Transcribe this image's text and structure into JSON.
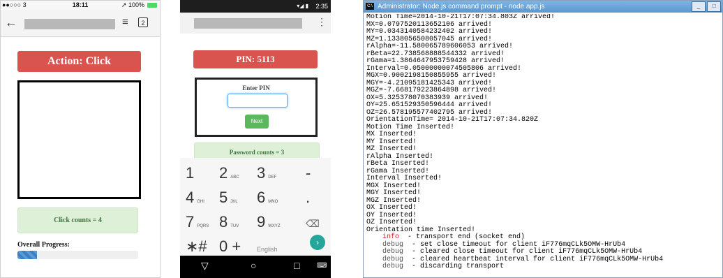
{
  "panel1": {
    "status": {
      "carrier": "●●○○○ 3",
      "time": "18:11",
      "battery": "➚ 100%"
    },
    "toolbar": {
      "back_icon": "arrow-left-icon",
      "menu_icon": "hamburger-icon",
      "tabs_count": "2"
    },
    "action_label": "Action: Click",
    "click_counts": "Click counts = 4",
    "progress_label": "Overall Progress:",
    "progress_fraction": 0.16
  },
  "panel2": {
    "status": {
      "icons": "▾◢ ▮",
      "time": "2:35"
    },
    "pin_label": "PIN: 5113",
    "enter_pin_label": "Enter PIN",
    "next_label": "Next",
    "password_counts": "Password counts = 3",
    "keys": [
      {
        "d": "1",
        "s": ""
      },
      {
        "d": "2",
        "s": "ABC"
      },
      {
        "d": "3",
        "s": "DEF"
      },
      {
        "d": "-",
        "s": ""
      },
      {
        "d": "4",
        "s": "GHI"
      },
      {
        "d": "5",
        "s": "JKL"
      },
      {
        "d": "6",
        "s": "MNO"
      },
      {
        "d": ".",
        "s": ""
      },
      {
        "d": "7",
        "s": "PQRS"
      },
      {
        "d": "8",
        "s": "TUV"
      },
      {
        "d": "9",
        "s": "WXYZ"
      },
      {
        "d": "⌫",
        "s": ""
      },
      {
        "d": "∗#",
        "s": ""
      },
      {
        "d": "0 +",
        "s": ""
      },
      {
        "d": "English",
        "s": ""
      },
      {
        "d": "",
        "s": ""
      }
    ],
    "nav": {
      "back": "▽",
      "home": "○",
      "recent": "□",
      "keyboard": "⌨"
    }
  },
  "panel3": {
    "title": "Administrator: Node.js command prompt - node  app.js",
    "lines": [
      "Motion Time=2014-10-21T17:07:34.803Z arrived!",
      "MX=0.0797520113652106 arrived!",
      "MY=0.0343140584232402 arrived!",
      "MZ=1.1338056508057045 arrived!",
      "rAlpha=-11.580065789606053 arrived!",
      "rBeta=22.738568888544332 arrived!",
      "rGama=1.3864647953759428 arrived!",
      "Interval=0.05000000074505806 arrived!",
      "MGX=0.9002198150855955 arrived!",
      "MGY=-4.21095181425343 arrived!",
      "MGZ=-7.668179223864898 arrived!",
      "OX=5.325378070383939 arrived!",
      "OY=25.651529350596444 arrived!",
      "OZ=26.578195577402795 arrived!",
      "OrientationTime= 2014-10-21T17:07:34.820Z",
      "Motion Time Inserted!",
      "MX Inserted!",
      "MY Inserted!",
      "MZ Inserted!",
      "rAlpha Inserted!",
      "rBeta Inserted!",
      "rGama Inserted!",
      "Interval Inserted!",
      "MGX Inserted!",
      "MGY Inserted!",
      "MGZ Inserted!",
      "OX Inserted!",
      "OY Inserted!",
      "OZ Inserted!",
      "Orientation time Inserted!"
    ],
    "logs": [
      {
        "level": "info",
        "msg": "- transport end (socket end)"
      },
      {
        "level": "debug",
        "msg": "- set close timeout for client iF776mqCLk5OMW-HrUb4"
      },
      {
        "level": "debug",
        "msg": "- cleared close timeout for client iF776mqCLk5OMW-HrUb4"
      },
      {
        "level": "debug",
        "msg": "- cleared heartbeat interval for client iF776mqCLk5OMW-HrUb4"
      },
      {
        "level": "debug",
        "msg": "- discarding transport"
      }
    ]
  }
}
